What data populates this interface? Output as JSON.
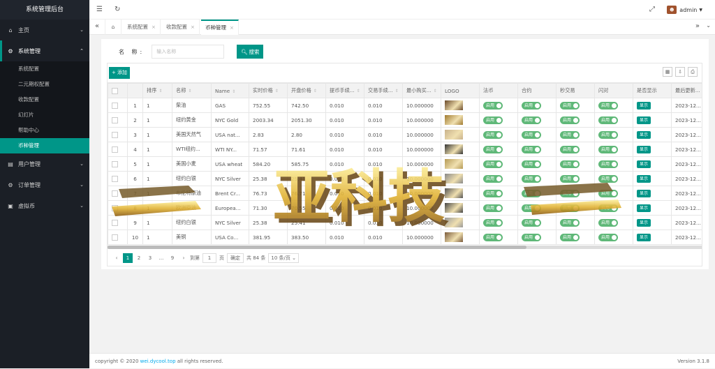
{
  "app_title": "系统管理后台",
  "sidebar": {
    "items": [
      {
        "label": "主页",
        "icon": "home-icon"
      },
      {
        "label": "系统管理",
        "icon": "gear-icon"
      },
      {
        "label": "用户管理",
        "icon": "user-icon"
      },
      {
        "label": "订单管理",
        "icon": "order-icon"
      },
      {
        "label": "虚拟币",
        "icon": "coin-icon"
      }
    ],
    "sub_items": [
      "系统配置",
      "二元期权配置",
      "收款配置",
      "幻灯片",
      "帮助中心",
      "币种管理"
    ]
  },
  "topbar": {
    "user": "admin"
  },
  "tabs": [
    {
      "label": "系统配置"
    },
    {
      "label": "收款配置"
    },
    {
      "label": "币种管理"
    }
  ],
  "search": {
    "label": "名 称:",
    "placeholder": "输入名称",
    "button": "搜索"
  },
  "toolbar": {
    "add_label": "添加"
  },
  "table": {
    "columns": [
      "排序",
      "名称",
      "Name",
      "实时价格",
      "开盘价格",
      "提币手续...",
      "交易手续...",
      "最小购买...",
      "LOGO",
      "法币",
      "合约",
      "秒交易",
      "闪对",
      "是否显示",
      "最后更新..."
    ],
    "rows": [
      {
        "num": "1",
        "sort": "1",
        "name": "柴油",
        "ename": "GAS",
        "price": "752.55",
        "open": "742.50",
        "wfee": "0.010",
        "tfee": "0.010",
        "min": "10.000000",
        "date": "2023-12...",
        "logo": "#6b4a2a"
      },
      {
        "num": "2",
        "sort": "1",
        "name": "纽约黄金",
        "ename": "NYC Gold",
        "price": "2003.34",
        "open": "2051.30",
        "wfee": "0.010",
        "tfee": "0.010",
        "min": "10.000000",
        "date": "2023-12...",
        "logo": "#a07a30"
      },
      {
        "num": "3",
        "sort": "1",
        "name": "美国天然气",
        "ename": "USA nat...",
        "price": "2.83",
        "open": "2.80",
        "wfee": "0.010",
        "tfee": "0.010",
        "min": "10.000000",
        "date": "2023-12...",
        "logo": "#c9b28c"
      },
      {
        "num": "4",
        "sort": "1",
        "name": "WTI纽约...",
        "ename": "WTI NY...",
        "price": "71.57",
        "open": "71.61",
        "wfee": "0.010",
        "tfee": "0.010",
        "min": "10.000000",
        "date": "2023-12...",
        "logo": "#333333"
      },
      {
        "num": "5",
        "sort": "1",
        "name": "美国小麦",
        "ename": "USA wheat",
        "price": "584.20",
        "open": "585.75",
        "wfee": "0.010",
        "tfee": "0.010",
        "min": "10.000000",
        "date": "2023-12...",
        "logo": "#b59a55"
      },
      {
        "num": "6",
        "sort": "1",
        "name": "纽约白银",
        "ename": "NYC Silver",
        "price": "25.38",
        "open": "25.41",
        "wfee": "0.010",
        "tfee": "0.010",
        "min": "10.000000",
        "date": "2023-12...",
        "logo": "#888888"
      },
      {
        "num": "7",
        "sort": "1",
        "name": "布伦特原油",
        "ename": "Brent Cr...",
        "price": "76.73",
        "open": "76.71",
        "wfee": "0.010",
        "tfee": "0.010",
        "min": "10.000000",
        "date": "2023-12...",
        "logo": "#555555"
      },
      {
        "num": "8",
        "sort": "1",
        "name": "欧洲原油",
        "ename": "Europea...",
        "price": "71.30",
        "open": "70.55",
        "wfee": "0.010",
        "tfee": "0.010",
        "min": "10.000000",
        "date": "2023-12...",
        "logo": "#444444"
      },
      {
        "num": "9",
        "sort": "1",
        "name": "纽约白银",
        "ename": "NYC Silver",
        "price": "25.38",
        "open": "25.41",
        "wfee": "0.010",
        "tfee": "0.010",
        "min": "10.000000",
        "date": "2023-12...",
        "logo": "#999999"
      },
      {
        "num": "10",
        "sort": "1",
        "name": "美铜",
        "ename": "USA Co...",
        "price": "381.95",
        "open": "383.50",
        "wfee": "0.010",
        "tfee": "0.010",
        "min": "10.000000",
        "date": "2023-12...",
        "logo": "#7a5a3a"
      }
    ],
    "switch_on": "启用",
    "show_label": "显示"
  },
  "pager": {
    "pages": [
      "1",
      "2",
      "3",
      "...",
      "9"
    ],
    "goto": "到第",
    "current": "1",
    "page_unit": "页",
    "confirm": "确定",
    "total": "共 84 条",
    "size": "10 条/页"
  },
  "footer": {
    "copyright": "copyright © 2020",
    "link": "wei.dycool.top",
    "rights": "all rights reserved.",
    "version": "Version 3.1.8"
  },
  "watermark_text": "亚科技",
  "colors": {
    "accent": "#009688",
    "sidebar": "#1b1f26",
    "switch": "#5fb878"
  }
}
